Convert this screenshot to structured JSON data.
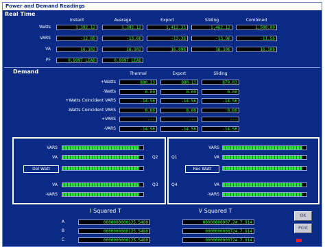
{
  "window": {
    "title": "Power and Demand Readings"
  },
  "realtime": {
    "title": "Real Time",
    "columns": [
      "Instant",
      "Average",
      "Export",
      "Sliding",
      "Combined"
    ],
    "rows": [
      {
        "label": "Watts",
        "values": [
          "1,392.12",
          "1,392.12",
          "1,412.33",
          "1,462.12",
          "1,500.00"
        ]
      },
      {
        "label": "VARS",
        "values": [
          "-12.85",
          "-13.66",
          "-13.36",
          "-13.96",
          "-11.56"
        ]
      },
      {
        "label": "VA",
        "values": [
          "16.102",
          "16.102",
          "16.098",
          "16.106",
          "16.108"
        ]
      },
      {
        "label": "PF",
        "values": [
          "0.9997 LEAD",
          "0.9997 LEAD"
        ]
      }
    ]
  },
  "demand": {
    "title": "Demand",
    "columns": [
      "Thermal",
      "Export",
      "Sliding"
    ],
    "rows": [
      {
        "label": "+Watts",
        "values": [
          "880.23",
          "880.13",
          "879.03"
        ]
      },
      {
        "label": "-Watts",
        "values": [
          "0.00",
          "0.00",
          "0.00"
        ]
      },
      {
        "label": "+Watts Coincident VARS",
        "values": [
          "-14.56",
          "-14.56",
          "-14.56"
        ]
      },
      {
        "label": "-Watts Coincident VARS",
        "values": [
          "0.00",
          "0.00",
          "0.00"
        ]
      },
      {
        "label": "+VARS",
        "values": [
          "---",
          "---",
          "---"
        ]
      },
      {
        "label": "-VARS",
        "values": [
          "-14.56",
          "-14.56",
          "-14.56"
        ]
      }
    ]
  },
  "quadrants": {
    "left_labels": [
      "VARS",
      "VA",
      "Del Watt",
      "VA",
      "-VARS"
    ],
    "right_labels": [
      "VARS",
      "VA",
      "Rec Watt",
      "VA",
      "-VARS"
    ],
    "quadrant_labels": [
      "Q2",
      "Q3",
      "Q1",
      "Q4"
    ],
    "left_fill": [
      0.95,
      0.95,
      0.95,
      0.95,
      0.95
    ],
    "right_fill": [
      0.95,
      0.95,
      0.95,
      0.95,
      0.95
    ]
  },
  "squared": {
    "i_title": "I Squared T",
    "v_title": "V Squared T",
    "phases": [
      "A",
      "B",
      "C"
    ],
    "i_values": [
      "0000000000125.5480",
      "0000000000125.5480",
      "0000000000125.5480"
    ],
    "v_values": [
      "00000000007.24.7.914",
      "0000000000724.7.914",
      "0000000000724.7.914"
    ]
  },
  "buttons": {
    "ok": "OK",
    "print": "Print"
  },
  "colors": {
    "background": "#0b2a86",
    "readout": "#2bff3a",
    "bar": "#26e63a"
  }
}
